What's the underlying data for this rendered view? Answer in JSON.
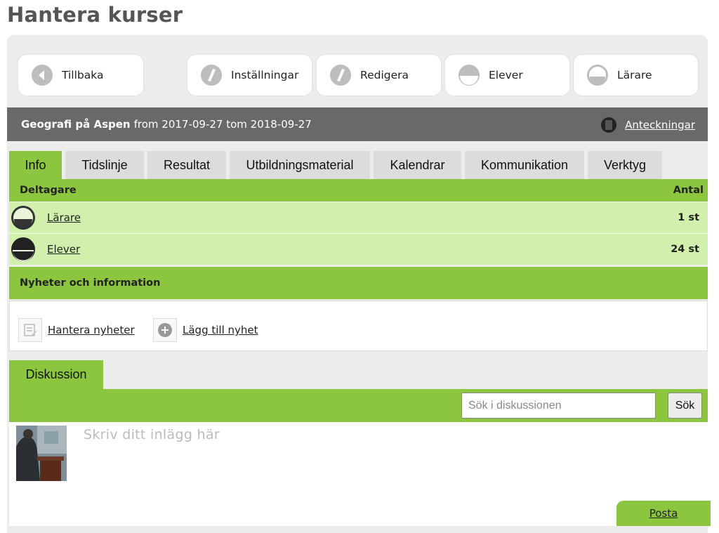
{
  "page": {
    "title": "Hantera kurser"
  },
  "top_buttons": [
    {
      "label": "Tillbaka",
      "icon": "back-arrow-icon"
    },
    {
      "label": "Inställningar",
      "icon": "pencil-icon"
    },
    {
      "label": "Redigera",
      "icon": "pencil-icon"
    },
    {
      "label": "Elever",
      "icon": "student-icon"
    },
    {
      "label": "Lärare",
      "icon": "teacher-icon"
    }
  ],
  "course": {
    "name": "Geografi på Aspen",
    "dates": "from 2017-09-27 tom 2018-09-27",
    "notes_label": "Anteckningar"
  },
  "tabs": [
    {
      "label": "Info",
      "active": true
    },
    {
      "label": "Tidslinje",
      "active": false
    },
    {
      "label": "Resultat",
      "active": false
    },
    {
      "label": "Utbildningsmaterial",
      "active": false
    },
    {
      "label": "Kalendrar",
      "active": false
    },
    {
      "label": "Kommunikation",
      "active": false
    },
    {
      "label": "Verktyg",
      "active": false
    }
  ],
  "participants": {
    "header_label": "Deltagare",
    "header_count": "Antal",
    "rows": [
      {
        "label": "Lärare",
        "count": "1 st",
        "icon": "teacher-icon"
      },
      {
        "label": "Elever",
        "count": "24 st",
        "icon": "student-icon"
      }
    ]
  },
  "news": {
    "header": "Nyheter och information",
    "manage_label": "Hantera nyheter",
    "add_label": "Lägg till nyhet"
  },
  "discussion": {
    "tab_label": "Diskussion",
    "search_placeholder": "Sök i diskussionen",
    "search_button": "Sök",
    "post_placeholder": "Skriv ditt inlägg här",
    "post_button": "Posta"
  },
  "colors": {
    "accent_green": "#8cc63f",
    "light_green": "#d2f0ad",
    "course_bar": "#696969",
    "panel_bg": "#ececec"
  }
}
